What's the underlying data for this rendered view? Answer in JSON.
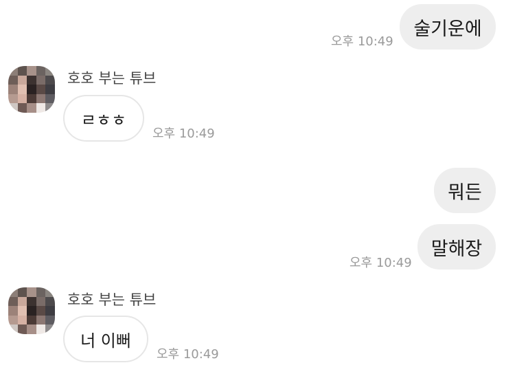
{
  "messages": [
    {
      "side": "out",
      "text": "술기운에",
      "time": "오후 10:49"
    },
    {
      "side": "in",
      "sender": "호호 부는 튜브",
      "text": "ㄹㅎㅎ",
      "time": "오후 10:49"
    },
    {
      "side": "out",
      "text": "뭐든"
    },
    {
      "side": "out",
      "text": "말해장",
      "time": "오후 10:49"
    },
    {
      "side": "in",
      "sender": "호호 부는 튜브",
      "text": "너 이뻐",
      "time": "오후 10:49"
    }
  ],
  "colors": {
    "outgoing_bubble": "#eeeeee",
    "incoming_bubble_border": "#e6e6e6",
    "timestamp": "#9a9a9a"
  },
  "avatar": {
    "icon": "pixelated-profile-photo"
  }
}
